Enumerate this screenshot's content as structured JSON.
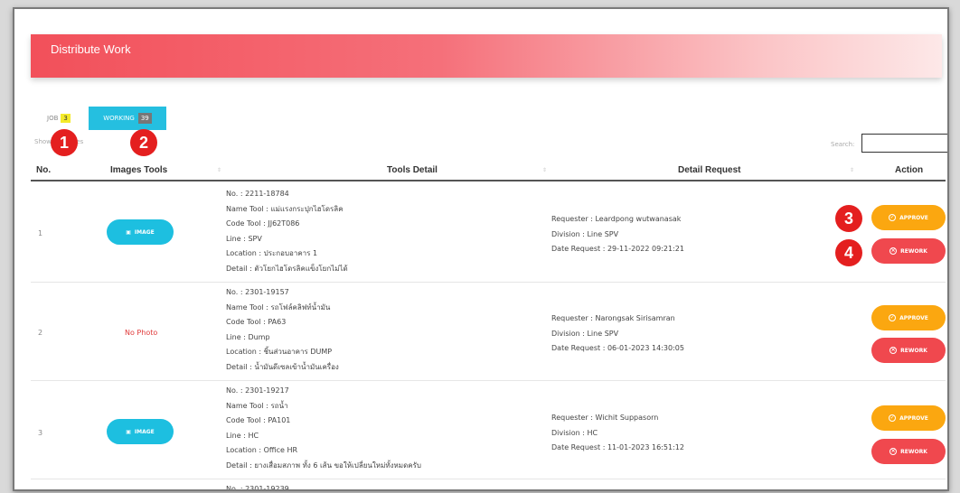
{
  "page": {
    "title": "Distribute Work"
  },
  "tabs": {
    "job": {
      "label": "JOB",
      "count": "3"
    },
    "working": {
      "label": "WORKING",
      "count": "39"
    }
  },
  "show_entries": "Show ... entries",
  "search": {
    "label": "Search:"
  },
  "markers": [
    "1",
    "2",
    "3",
    "4"
  ],
  "table": {
    "headers": [
      "No.",
      "Images Tools",
      "Tools Detail",
      "Detail Request",
      "Action"
    ],
    "buttons": {
      "image": "IMAGE",
      "approve": "APPROVE",
      "rework": "REWORK",
      "no_photo": "No Photo"
    },
    "rows": [
      {
        "no": "1",
        "has_image": true,
        "detail": [
          "No. : 2211-18784",
          "Name Tool : แม่แรงกระปุกไฮโดรลิค",
          "Code Tool : JJ62T086",
          "Line : SPV",
          "Location : ประกอบอาคาร 1",
          "Detail : ตัวโยกไฮโดรลิคแข็งโยกไม่ได้"
        ],
        "request": [
          "Requester : Leardpong wutwanasak",
          "Division : Line SPV",
          "Date Request : 29-11-2022 09:21:21"
        ]
      },
      {
        "no": "2",
        "has_image": false,
        "detail": [
          "No. : 2301-19157",
          "Name Tool : รถโฟล์คลิฟท์น้ำมัน",
          "Code Tool : PA63",
          "Line : Dump",
          "Location : ชิ้นส่วนอาคาร DUMP",
          "Detail : น้ำมันดีเซลเข้าน้ำมันเครื่อง"
        ],
        "request": [
          "Requester : Narongsak Sirisamran",
          "Division : Line SPV",
          "Date Request : 06-01-2023 14:30:05"
        ]
      },
      {
        "no": "3",
        "has_image": true,
        "detail": [
          "No. : 2301-19217",
          "Name Tool : รถน้ำ",
          "Code Tool : PA101",
          "Line : HC",
          "Location : Office HR",
          "Detail : ยางเสื่อมสภาพ ทั้ง 6 เส้น ขอให้เปลี่ยนใหม่ทั้งหมดครับ"
        ],
        "request": [
          "Requester : Wichit Suppasorn",
          "Division : HC",
          "Date Request : 11-01-2023 16:51:12"
        ]
      },
      {
        "no": "",
        "has_image": false,
        "detail": [
          "No. : 2301-19239"
        ],
        "request": []
      }
    ]
  },
  "colors": {
    "banner_start": "#f2505a",
    "working_tab": "#25bfe0",
    "approve": "#fba710",
    "rework": "#f0484e",
    "marker": "#e41f1f"
  }
}
